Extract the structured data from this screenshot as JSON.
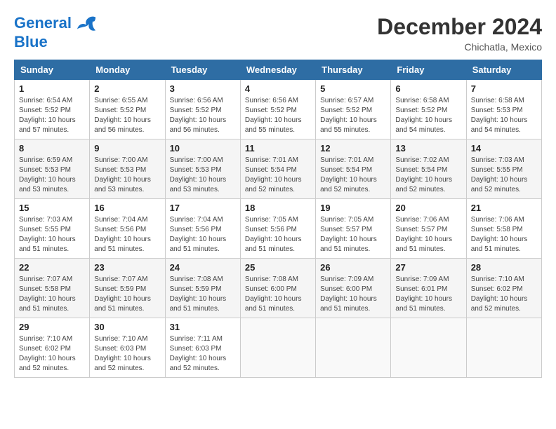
{
  "header": {
    "logo_line1": "General",
    "logo_line2": "Blue",
    "month_title": "December 2024",
    "subtitle": "Chichatla, Mexico"
  },
  "weekdays": [
    "Sunday",
    "Monday",
    "Tuesday",
    "Wednesday",
    "Thursday",
    "Friday",
    "Saturday"
  ],
  "weeks": [
    [
      {
        "day": "1",
        "sunrise": "Sunrise: 6:54 AM",
        "sunset": "Sunset: 5:52 PM",
        "daylight": "Daylight: 10 hours and 57 minutes."
      },
      {
        "day": "2",
        "sunrise": "Sunrise: 6:55 AM",
        "sunset": "Sunset: 5:52 PM",
        "daylight": "Daylight: 10 hours and 56 minutes."
      },
      {
        "day": "3",
        "sunrise": "Sunrise: 6:56 AM",
        "sunset": "Sunset: 5:52 PM",
        "daylight": "Daylight: 10 hours and 56 minutes."
      },
      {
        "day": "4",
        "sunrise": "Sunrise: 6:56 AM",
        "sunset": "Sunset: 5:52 PM",
        "daylight": "Daylight: 10 hours and 55 minutes."
      },
      {
        "day": "5",
        "sunrise": "Sunrise: 6:57 AM",
        "sunset": "Sunset: 5:52 PM",
        "daylight": "Daylight: 10 hours and 55 minutes."
      },
      {
        "day": "6",
        "sunrise": "Sunrise: 6:58 AM",
        "sunset": "Sunset: 5:52 PM",
        "daylight": "Daylight: 10 hours and 54 minutes."
      },
      {
        "day": "7",
        "sunrise": "Sunrise: 6:58 AM",
        "sunset": "Sunset: 5:53 PM",
        "daylight": "Daylight: 10 hours and 54 minutes."
      }
    ],
    [
      {
        "day": "8",
        "sunrise": "Sunrise: 6:59 AM",
        "sunset": "Sunset: 5:53 PM",
        "daylight": "Daylight: 10 hours and 53 minutes."
      },
      {
        "day": "9",
        "sunrise": "Sunrise: 7:00 AM",
        "sunset": "Sunset: 5:53 PM",
        "daylight": "Daylight: 10 hours and 53 minutes."
      },
      {
        "day": "10",
        "sunrise": "Sunrise: 7:00 AM",
        "sunset": "Sunset: 5:53 PM",
        "daylight": "Daylight: 10 hours and 53 minutes."
      },
      {
        "day": "11",
        "sunrise": "Sunrise: 7:01 AM",
        "sunset": "Sunset: 5:54 PM",
        "daylight": "Daylight: 10 hours and 52 minutes."
      },
      {
        "day": "12",
        "sunrise": "Sunrise: 7:01 AM",
        "sunset": "Sunset: 5:54 PM",
        "daylight": "Daylight: 10 hours and 52 minutes."
      },
      {
        "day": "13",
        "sunrise": "Sunrise: 7:02 AM",
        "sunset": "Sunset: 5:54 PM",
        "daylight": "Daylight: 10 hours and 52 minutes."
      },
      {
        "day": "14",
        "sunrise": "Sunrise: 7:03 AM",
        "sunset": "Sunset: 5:55 PM",
        "daylight": "Daylight: 10 hours and 52 minutes."
      }
    ],
    [
      {
        "day": "15",
        "sunrise": "Sunrise: 7:03 AM",
        "sunset": "Sunset: 5:55 PM",
        "daylight": "Daylight: 10 hours and 51 minutes."
      },
      {
        "day": "16",
        "sunrise": "Sunrise: 7:04 AM",
        "sunset": "Sunset: 5:56 PM",
        "daylight": "Daylight: 10 hours and 51 minutes."
      },
      {
        "day": "17",
        "sunrise": "Sunrise: 7:04 AM",
        "sunset": "Sunset: 5:56 PM",
        "daylight": "Daylight: 10 hours and 51 minutes."
      },
      {
        "day": "18",
        "sunrise": "Sunrise: 7:05 AM",
        "sunset": "Sunset: 5:56 PM",
        "daylight": "Daylight: 10 hours and 51 minutes."
      },
      {
        "day": "19",
        "sunrise": "Sunrise: 7:05 AM",
        "sunset": "Sunset: 5:57 PM",
        "daylight": "Daylight: 10 hours and 51 minutes."
      },
      {
        "day": "20",
        "sunrise": "Sunrise: 7:06 AM",
        "sunset": "Sunset: 5:57 PM",
        "daylight": "Daylight: 10 hours and 51 minutes."
      },
      {
        "day": "21",
        "sunrise": "Sunrise: 7:06 AM",
        "sunset": "Sunset: 5:58 PM",
        "daylight": "Daylight: 10 hours and 51 minutes."
      }
    ],
    [
      {
        "day": "22",
        "sunrise": "Sunrise: 7:07 AM",
        "sunset": "Sunset: 5:58 PM",
        "daylight": "Daylight: 10 hours and 51 minutes."
      },
      {
        "day": "23",
        "sunrise": "Sunrise: 7:07 AM",
        "sunset": "Sunset: 5:59 PM",
        "daylight": "Daylight: 10 hours and 51 minutes."
      },
      {
        "day": "24",
        "sunrise": "Sunrise: 7:08 AM",
        "sunset": "Sunset: 5:59 PM",
        "daylight": "Daylight: 10 hours and 51 minutes."
      },
      {
        "day": "25",
        "sunrise": "Sunrise: 7:08 AM",
        "sunset": "Sunset: 6:00 PM",
        "daylight": "Daylight: 10 hours and 51 minutes."
      },
      {
        "day": "26",
        "sunrise": "Sunrise: 7:09 AM",
        "sunset": "Sunset: 6:00 PM",
        "daylight": "Daylight: 10 hours and 51 minutes."
      },
      {
        "day": "27",
        "sunrise": "Sunrise: 7:09 AM",
        "sunset": "Sunset: 6:01 PM",
        "daylight": "Daylight: 10 hours and 51 minutes."
      },
      {
        "day": "28",
        "sunrise": "Sunrise: 7:10 AM",
        "sunset": "Sunset: 6:02 PM",
        "daylight": "Daylight: 10 hours and 52 minutes."
      }
    ],
    [
      {
        "day": "29",
        "sunrise": "Sunrise: 7:10 AM",
        "sunset": "Sunset: 6:02 PM",
        "daylight": "Daylight: 10 hours and 52 minutes."
      },
      {
        "day": "30",
        "sunrise": "Sunrise: 7:10 AM",
        "sunset": "Sunset: 6:03 PM",
        "daylight": "Daylight: 10 hours and 52 minutes."
      },
      {
        "day": "31",
        "sunrise": "Sunrise: 7:11 AM",
        "sunset": "Sunset: 6:03 PM",
        "daylight": "Daylight: 10 hours and 52 minutes."
      },
      null,
      null,
      null,
      null
    ]
  ]
}
